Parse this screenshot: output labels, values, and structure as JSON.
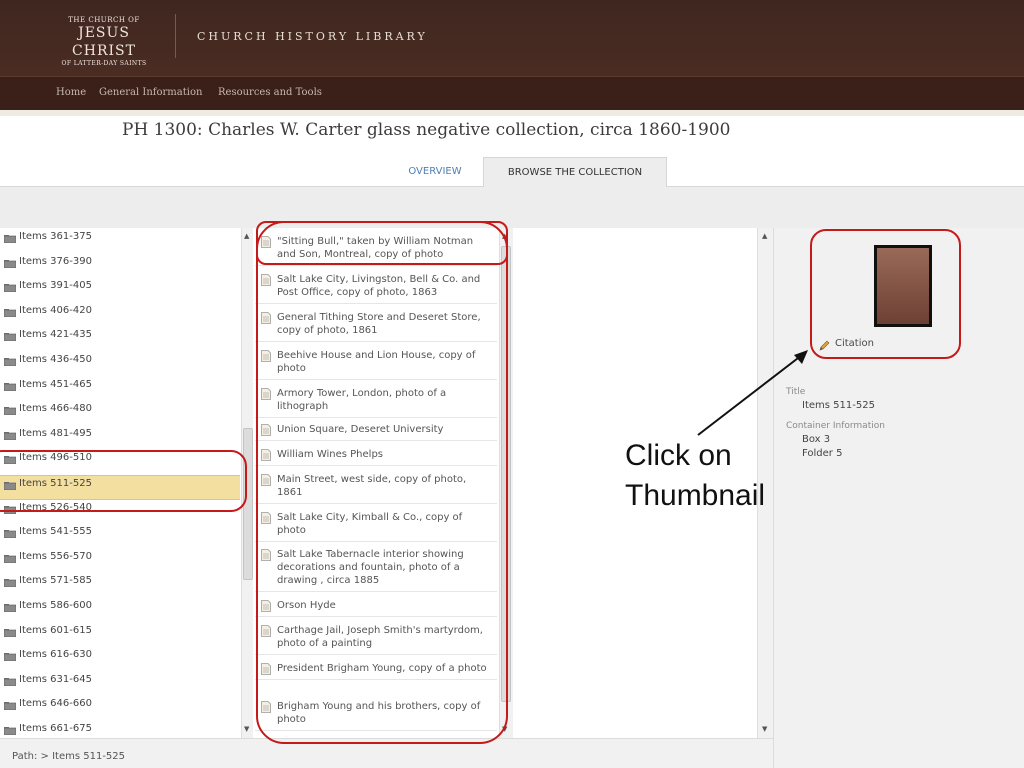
{
  "header": {
    "logo_line1": "THE CHURCH OF",
    "logo_line2": "JESUS CHRIST",
    "logo_line3": "OF LATTER-DAY SAINTS",
    "site_title": "CHURCH HISTORY LIBRARY"
  },
  "nav": [
    "Home",
    "General Information",
    "Resources and Tools"
  ],
  "page_title": "PH 1300: Charles W. Carter glass negative collection, circa 1860-1900",
  "tabs": {
    "overview": "OVERVIEW",
    "browse": "BROWSE THE COLLECTION"
  },
  "tree": [
    "Items 361-375",
    "Items 376-390",
    "Items 391-405",
    "Items 406-420",
    "Items 421-435",
    "Items 436-450",
    "Items 451-465",
    "Items 466-480",
    "Items 481-495",
    "Items 496-510",
    "Items 511-525",
    "Items 526-540",
    "Items 541-555",
    "Items 556-570",
    "Items 571-585",
    "Items 586-600",
    "Items 601-615",
    "Items 616-630",
    "Items 631-645",
    "Items 646-660",
    "Items 661-675"
  ],
  "selected_tree_item": "Items 511-525",
  "docs": [
    "\"Sitting Bull,\" taken by William Notman and Son, Montreal, copy of photo",
    "Salt Lake City, Livingston, Bell & Co. and Post Office, copy of photo, 1863",
    "General Tithing Store and Deseret Store, copy of photo, 1861",
    "Beehive House and Lion House, copy of photo",
    "Armory Tower, London, photo of a lithograph",
    "Union Square, Deseret University",
    "William Wines Phelps",
    "Main Street, west side, copy of photo, 1861",
    "Salt Lake City, Kimball & Co., copy of photo",
    "Salt Lake Tabernacle interior showing decorations and fountain, photo of a drawing , circa 1885",
    "Orson Hyde",
    "Carthage Jail, Joseph Smith's martyrdom, photo of a painting",
    "President Brigham Young, copy of a photo",
    "Brigham Young and his brothers, copy of photo"
  ],
  "detail": {
    "citation": "Citation",
    "title_label": "Title",
    "title_value": "Items 511-525",
    "container_label": "Container Information",
    "box": "Box 3",
    "folder": "Folder 5"
  },
  "path": "Path: > Items 511-525",
  "annotation": "Click on Thumbnail",
  "colors": {
    "accent_red": "#c41a1a",
    "header_brown": "#3f2720",
    "selected_row": "#f3dfa0"
  }
}
